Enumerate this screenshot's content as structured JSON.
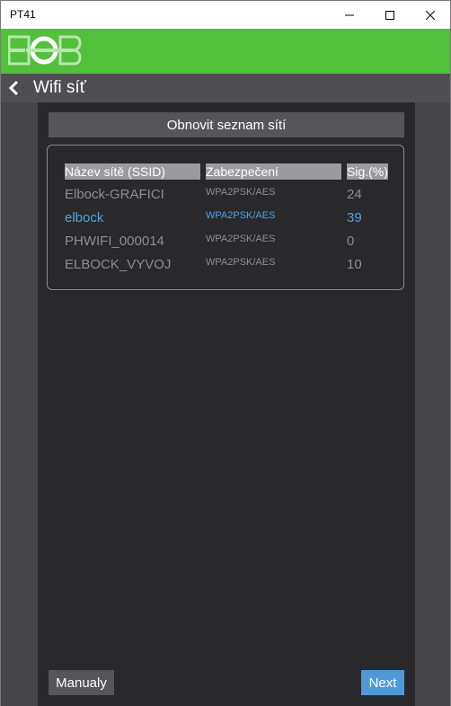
{
  "window": {
    "title": "PT41"
  },
  "brand": {
    "color": "#52c03a",
    "logo_icon": "eob-logo"
  },
  "nav": {
    "title": "Wifi síť"
  },
  "refresh_button": {
    "label": "Obnovit seznam sítí"
  },
  "network_table": {
    "columns": [
      "Název sítě (SSID)",
      "Zabezpečení",
      "Sig.(%)"
    ],
    "rows": [
      {
        "ssid": "Elbock-GRAFICI",
        "security": "WPA2PSK/AES",
        "signal": "24",
        "selected": false
      },
      {
        "ssid": "elbock",
        "security": "WPA2PSK/AES",
        "signal": "39",
        "selected": true
      },
      {
        "ssid": "PHWIFI_000014",
        "security": "WPA2PSK/AES",
        "signal": "0",
        "selected": false
      },
      {
        "ssid": "ELBOCK_VYVOJ",
        "security": "WPA2PSK/AES",
        "signal": "10",
        "selected": false
      }
    ]
  },
  "footer": {
    "manual_label": "Manualy",
    "next_label": "Next"
  },
  "colors": {
    "accent": "#4f99d8",
    "selected_text": "#4fa3e6",
    "panel": "#29292b"
  }
}
